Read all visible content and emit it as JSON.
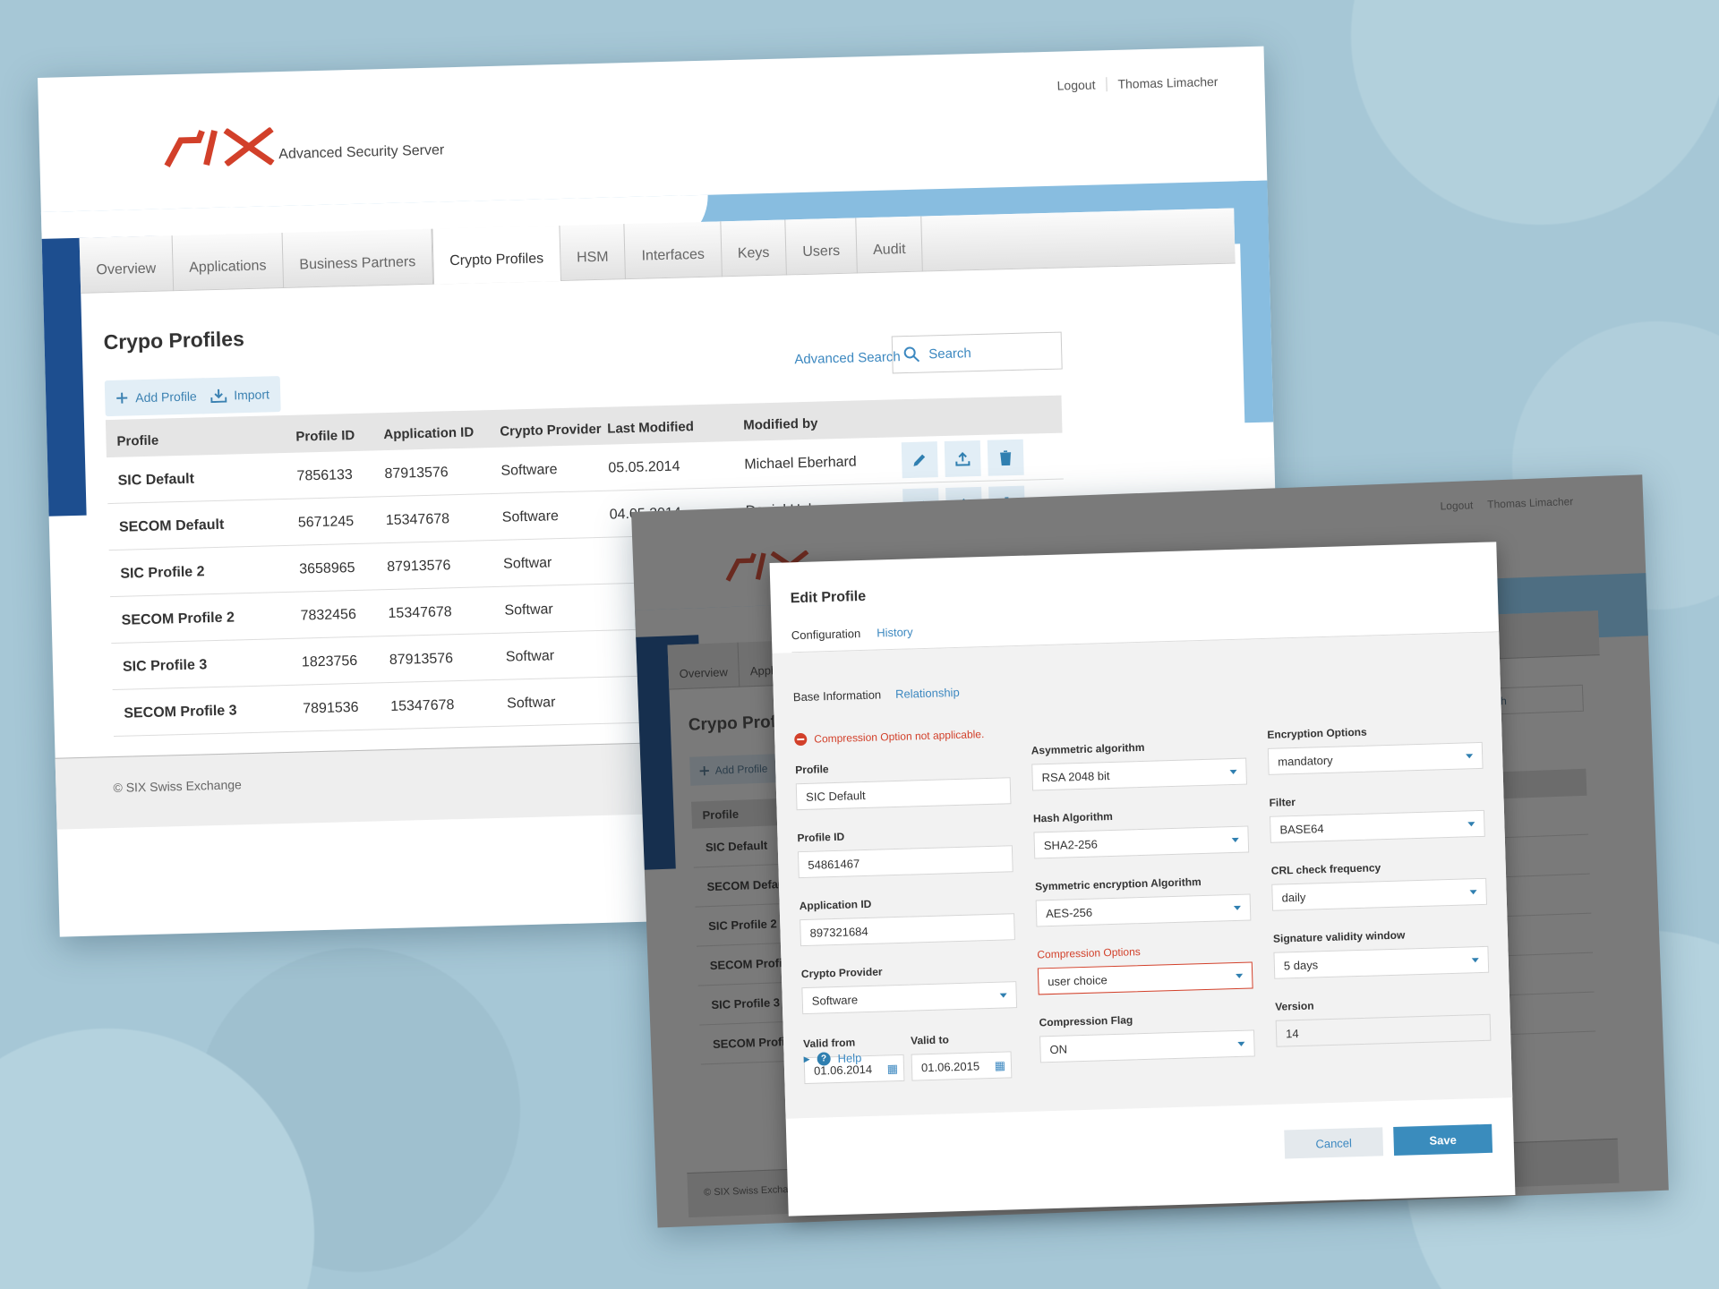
{
  "app": {
    "brand": "SIX",
    "subtitle": "Advanced Security Server",
    "logout": "Logout",
    "user": "Thomas Limacher",
    "footer": "© SIX Swiss Exchange",
    "brand_color": "#d2402a",
    "accent": "#3c88c0"
  },
  "nav": {
    "tabs": [
      "Overview",
      "Applications",
      "Business Partners",
      "Crypto Profiles",
      "HSM",
      "Interfaces",
      "Keys",
      "Users",
      "Audit"
    ],
    "active": "Crypto Profiles"
  },
  "page": {
    "title": "Crypo Profiles",
    "add_label": "Add Profile",
    "import_label": "Import",
    "advanced_search": "Advanced Search",
    "search_placeholder": "Search"
  },
  "table": {
    "headers": [
      "Profile",
      "Profile ID",
      "Application ID",
      "Crypto Provider",
      "Last Modified",
      "Modified by"
    ],
    "rows": [
      {
        "profile": "SIC Default",
        "profile_id": "7856133",
        "app_id": "87913576",
        "provider": "Software",
        "modified": "05.05.2014",
        "by": "Michael Eberhard"
      },
      {
        "profile": "SECOM Default",
        "profile_id": "5671245",
        "app_id": "15347678",
        "provider": "Software",
        "modified": "04.05.2014",
        "by": "Daniel Huber"
      },
      {
        "profile": "SIC Profile 2",
        "profile_id": "3658965",
        "app_id": "87913576",
        "provider": "Softwar",
        "modified": "",
        "by": ""
      },
      {
        "profile": "SECOM Profile 2",
        "profile_id": "7832456",
        "app_id": "15347678",
        "provider": "Softwar",
        "modified": "",
        "by": ""
      },
      {
        "profile": "SIC Profile 3",
        "profile_id": "1823756",
        "app_id": "87913576",
        "provider": "Softwar",
        "modified": "",
        "by": ""
      },
      {
        "profile": "SECOM Profile 3",
        "profile_id": "7891536",
        "app_id": "15347678",
        "provider": "Softwar",
        "modified": "",
        "by": ""
      }
    ],
    "action_icons": [
      "pencil-icon",
      "upload-icon",
      "trash-icon"
    ]
  },
  "background_screen": {
    "tabs": [
      "Overview",
      "Appli"
    ],
    "title": "Crypo Profi",
    "add_label": "Add Profile",
    "search_fragment": "arch",
    "header": "Profile",
    "rows": [
      "SIC Default",
      "SECOM Default",
      "SIC Profile 2",
      "SECOM Profile 2",
      "SIC Profile 3",
      "SECOM Profile 3"
    ],
    "footer": "© SIX Swiss Exchan"
  },
  "modal": {
    "title": "Edit Profile",
    "tabs": [
      "Configuration",
      "History"
    ],
    "subtabs": [
      "Base Information",
      "Relationship"
    ],
    "error": "Compression Option not applicable.",
    "fields": {
      "profile": {
        "label": "Profile",
        "value": "SIC Default"
      },
      "profile_id": {
        "label": "Profile ID",
        "value": "54861467"
      },
      "application_id": {
        "label": "Application ID",
        "value": "897321684"
      },
      "crypto_provider": {
        "label": "Crypto Provider",
        "value": "Software"
      },
      "valid_from": {
        "label": "Valid from",
        "value": "01.06.2014"
      },
      "valid_to": {
        "label": "Valid to",
        "value": "01.06.2015"
      },
      "asym": {
        "label": "Asymmetric algorithm",
        "value": "RSA 2048 bit"
      },
      "hash": {
        "label": "Hash Algorithm",
        "value": "SHA2-256"
      },
      "sym": {
        "label": "Symmetric encryption Algorithm",
        "value": "AES-256"
      },
      "compression": {
        "label": "Compression Options",
        "value": "user choice"
      },
      "compression_flag": {
        "label": "Compression Flag",
        "value": "ON"
      },
      "encryption": {
        "label": "Encryption Options",
        "value": "mandatory"
      },
      "filter": {
        "label": "Filter",
        "value": "BASE64"
      },
      "crl": {
        "label": "CRL check frequency",
        "value": "daily"
      },
      "sig_window": {
        "label": "Signature validity window",
        "value": "5 days"
      },
      "version": {
        "label": "Version",
        "value": "14"
      }
    },
    "help": "Help",
    "cancel": "Cancel",
    "save": "Save"
  }
}
